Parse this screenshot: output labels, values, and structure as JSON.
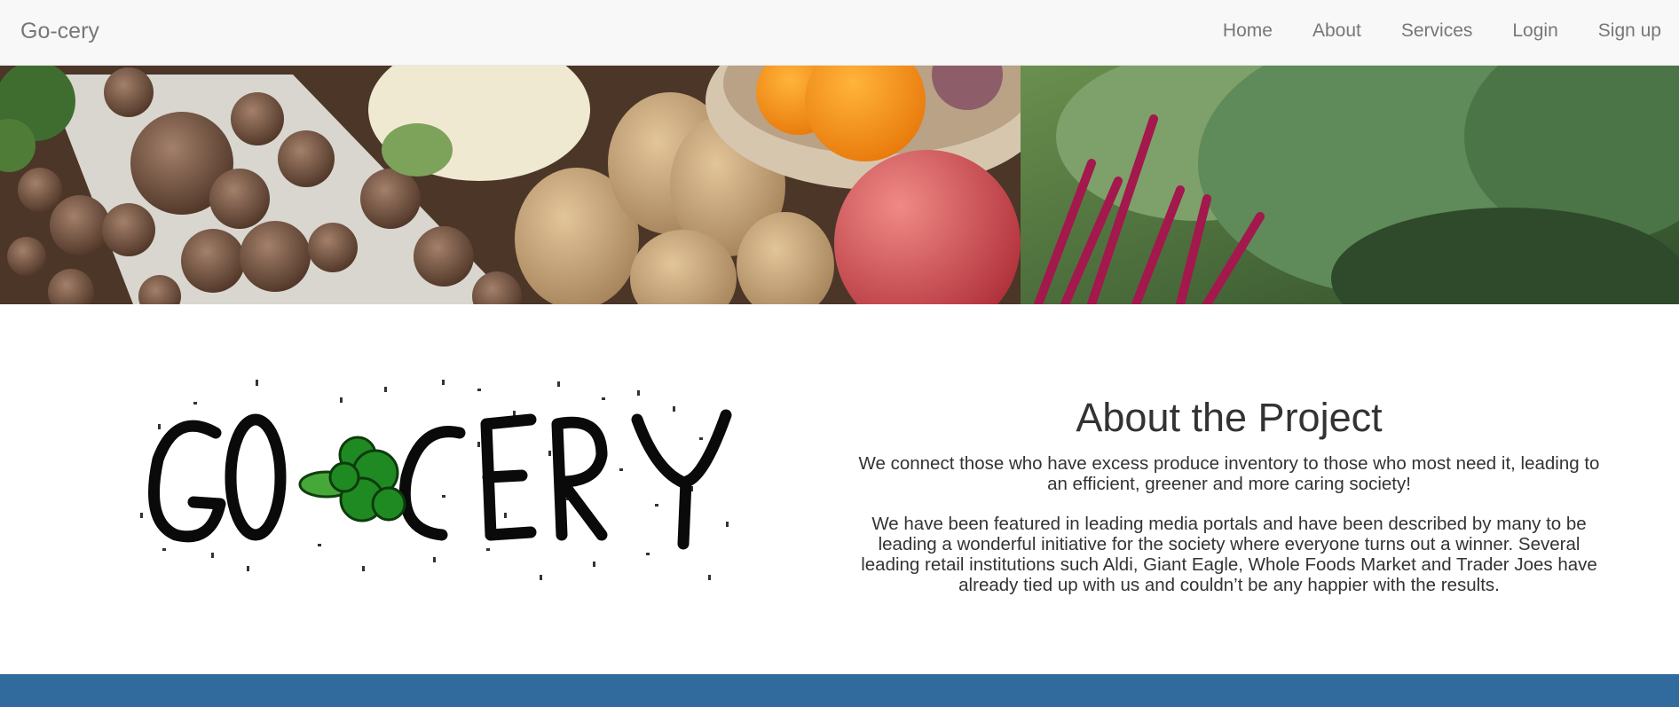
{
  "navbar": {
    "brand": "Go-cery",
    "links": [
      "Home",
      "About",
      "Services",
      "Login",
      "Sign up"
    ]
  },
  "logo": {
    "text": "GO-CERY",
    "icon": "broccoli-icon"
  },
  "about": {
    "title": "About the Project",
    "paragraphs": [
      "We connect those who have excess produce inventory to those who most need it, leading to an efficient, greener and more caring society!",
      "We have been featured in leading media portals and have been described by many to be leading a wonderful initiative for the society where everyone turns out a winner. Several leading retail institutions such Aldi, Giant Eagle, Whole Foods Market and Trader Joes have already tied up with us and couldn’t be any happier with the results."
    ]
  },
  "colors": {
    "navbar_bg": "#f8f8f8",
    "footer_bg": "#316a9c",
    "text": "#333333",
    "nav_text": "#777777"
  }
}
